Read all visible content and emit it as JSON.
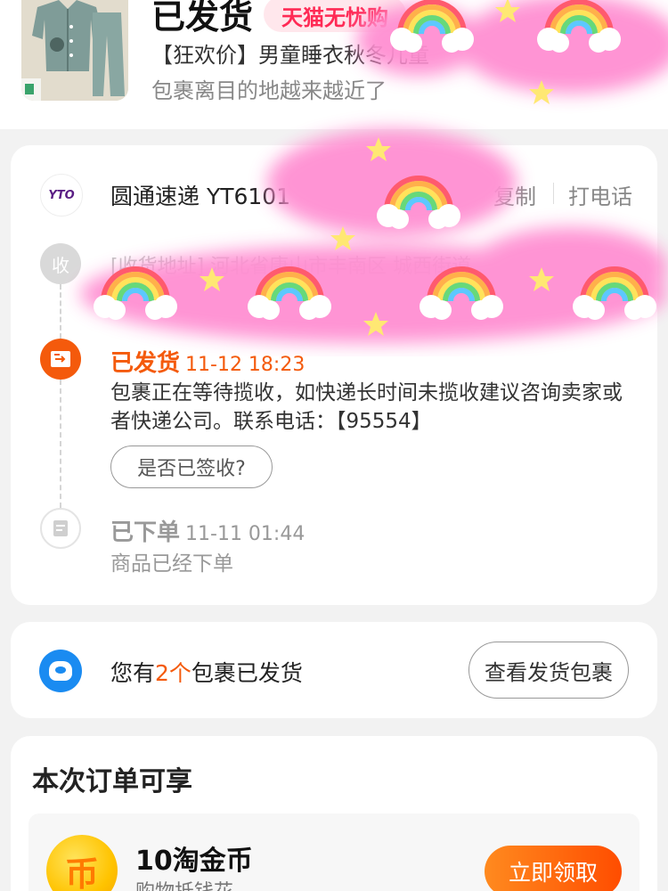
{
  "header": {
    "status_title": "已发货",
    "badge": "天猫无忧购",
    "product_name": "【狂欢价】男童睡衣秋冬儿童",
    "subtitle": "包裹离目的地越来越近了"
  },
  "logistics": {
    "courier_logo_text": "YTO",
    "courier_name": "圆通速递 YT6101",
    "actions": {
      "copy": "复制",
      "call": "打电话"
    },
    "receive": {
      "dot_label": "收",
      "address": "[收货地址] 河北省唐山市丰南区 城西街道"
    },
    "events": [
      {
        "title": "已发货",
        "time": "11-12 18:23",
        "description": "包裹正在等待揽收，如快递长时间未揽收建议咨询卖家或者快递公司。联系电话：【95554】",
        "icon": "shipping-box-icon"
      },
      {
        "title": "已下单",
        "time": "11-11 01:44",
        "description": "商品已经下单",
        "icon": "document-icon"
      }
    ],
    "signed_button": "是否已签收?"
  },
  "packages": {
    "text_prefix": "您有",
    "count_text": "2个",
    "text_suffix": "包裹已发货",
    "button": "查看发货包裹",
    "icon": "package-icon"
  },
  "benefits": {
    "title": "本次订单可享",
    "item": {
      "icon_glyph": "币",
      "title": "10淘金币",
      "subtitle": "购物抵钱花",
      "button": "立即领取"
    }
  },
  "colors": {
    "accent_orange": "#f45a0c",
    "tmall_red": "#ff2a55",
    "blue": "#1a8bf1",
    "sticker_pink": "#ff8fd2"
  }
}
